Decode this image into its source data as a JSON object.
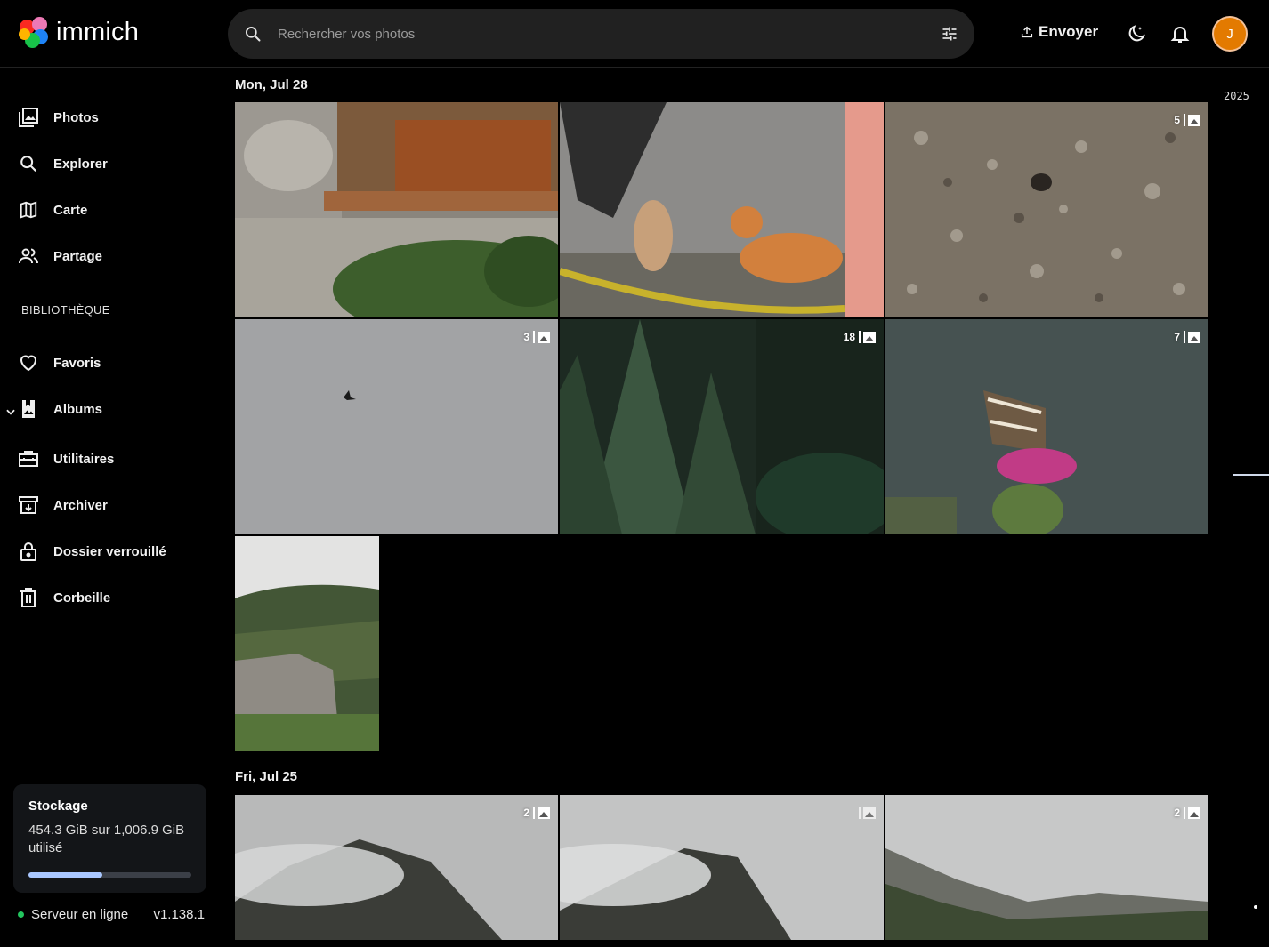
{
  "app": {
    "name": "immich"
  },
  "search": {
    "placeholder": "Rechercher vos photos"
  },
  "header": {
    "upload_label": "Envoyer",
    "avatar_initial": "J"
  },
  "sidebar": {
    "items": [
      {
        "label": "Photos",
        "icon": "photos-icon"
      },
      {
        "label": "Explorer",
        "icon": "search-icon"
      },
      {
        "label": "Carte",
        "icon": "map-icon"
      },
      {
        "label": "Partage",
        "icon": "people-icon"
      }
    ],
    "library_label": "BIBLIOTHÈQUE",
    "library_items": [
      {
        "label": "Favoris",
        "icon": "heart-icon"
      },
      {
        "label": "Albums",
        "icon": "album-icon"
      },
      {
        "label": "Utilitaires",
        "icon": "toolbox-icon"
      },
      {
        "label": "Archiver",
        "icon": "archive-icon"
      },
      {
        "label": "Dossier verrouillé",
        "icon": "lock-icon"
      },
      {
        "label": "Corbeille",
        "icon": "trash-icon"
      }
    ]
  },
  "storage": {
    "title": "Stockage",
    "usage": "454.3 GiB sur 1,006.9 GiB utilisé",
    "used_fraction": 0.451
  },
  "server": {
    "status": "Serveur en ligne",
    "version": "v1.138.1"
  },
  "timeline": {
    "groups": [
      {
        "date": "Mon, Jul 28",
        "stack_counts": [
          "5",
          "3",
          "18",
          "7"
        ]
      },
      {
        "date": "Fri, Jul 25",
        "stack_counts": [
          "2",
          "",
          "2"
        ]
      }
    ]
  },
  "scrubber": {
    "year": "2025"
  },
  "colors": {
    "accent": "#a9c7ff",
    "avatar": "#e37a00",
    "online": "#22c55e"
  }
}
